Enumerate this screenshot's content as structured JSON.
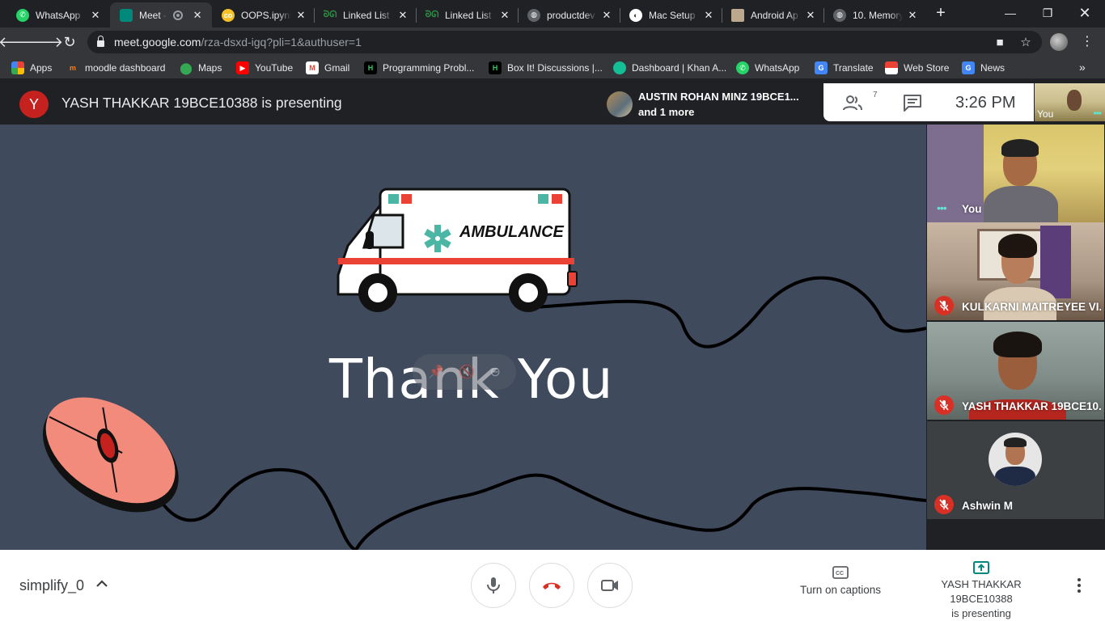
{
  "browser": {
    "tabs": [
      {
        "title": "WhatsApp",
        "active": false
      },
      {
        "title": "Meet - ",
        "active": true
      },
      {
        "title": "OOPS.ipynb",
        "active": false
      },
      {
        "title": "Linked List |",
        "active": false
      },
      {
        "title": "Linked List |",
        "active": false
      },
      {
        "title": "productdev",
        "active": false
      },
      {
        "title": "Mac Setup |",
        "active": false
      },
      {
        "title": "Android Ap",
        "active": false
      },
      {
        "title": "10. Memory",
        "active": false
      }
    ],
    "url_host": "meet.google.com",
    "url_path": "/rza-dsxd-igq?pli=1&authuser=1",
    "bookmarks": [
      {
        "label": "Apps"
      },
      {
        "label": "moodle dashboard"
      },
      {
        "label": "Maps"
      },
      {
        "label": "YouTube"
      },
      {
        "label": "Gmail"
      },
      {
        "label": "Programming Probl..."
      },
      {
        "label": "Box It! Discussions |..."
      },
      {
        "label": "Dashboard | Khan A..."
      },
      {
        "label": "WhatsApp"
      },
      {
        "label": "Translate"
      },
      {
        "label": "Web Store"
      },
      {
        "label": "News"
      }
    ]
  },
  "meet": {
    "presenter_initial": "Y",
    "presenting_banner": "YASH THAKKAR 19BCE10388 is presenting",
    "speaker_chip": {
      "line1": "AUSTIN ROHAN MINZ 19BCE1...",
      "line2": "and 1 more"
    },
    "participant_count": "7",
    "clock": "3:26  PM",
    "self_mini_label": "You",
    "slide": {
      "title_text": "Thank You",
      "ambulance_label": "AMBULANCE"
    },
    "participants": [
      {
        "name": "You",
        "muted": false
      },
      {
        "name": "KULKARNI MAITREYEE VI...",
        "muted": true
      },
      {
        "name": "YASH THAKKAR 19BCE10...",
        "muted": true
      },
      {
        "name": "Ashwin M",
        "muted": true
      }
    ],
    "bottom_bar": {
      "meeting_code": "simplify_0",
      "captions_label": "Turn on captions",
      "presenting_line1": "YASH THAKKAR 19BCE10388",
      "presenting_line2": "is presenting"
    }
  },
  "colors": {
    "stage_bg": "#3f4a5c",
    "hangup_red": "#d93025",
    "mouse_pink": "#f28b7c",
    "ambulance_stripe": "#ea4335",
    "medic_teal": "#4bb6a4"
  }
}
